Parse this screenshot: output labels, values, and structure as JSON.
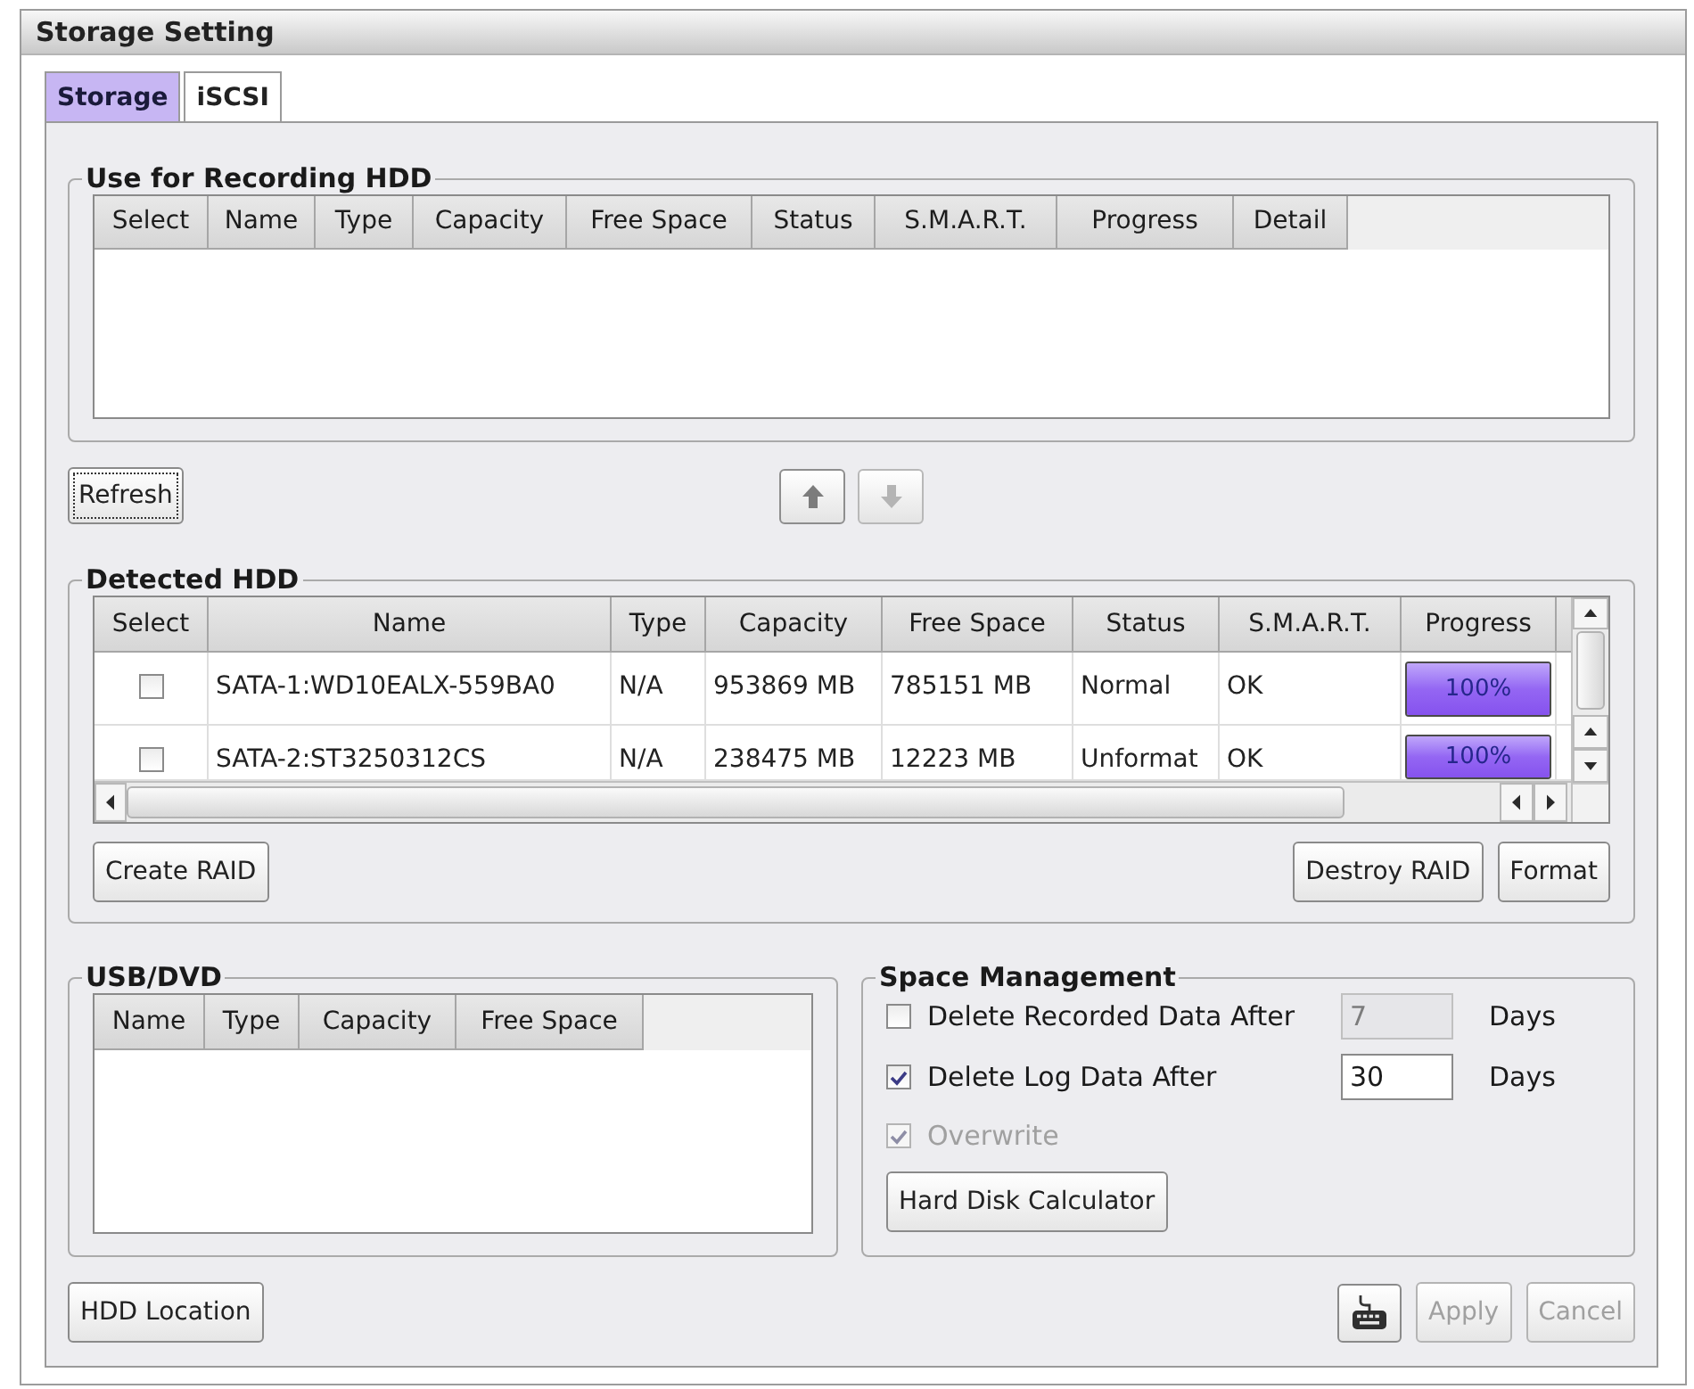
{
  "window": {
    "title": "Storage Setting"
  },
  "tabs": [
    {
      "label": "Storage",
      "selected": true
    },
    {
      "label": "iSCSI",
      "selected": false
    }
  ],
  "recording_hdd": {
    "title": "Use for Recording HDD",
    "columns": [
      "Select",
      "Name",
      "Type",
      "Capacity",
      "Free Space",
      "Status",
      "S.M.A.R.T.",
      "Progress",
      "Detail"
    ]
  },
  "refresh_button": {
    "label": "Refresh",
    "focused": true
  },
  "order_buttons": [
    {
      "kind": "up",
      "disabled": false
    },
    {
      "kind": "down",
      "disabled": true
    }
  ],
  "detected_hdd": {
    "title": "Detected HDD",
    "columns": [
      "Select",
      "Name",
      "Type",
      "Capacity",
      "Free Space",
      "Status",
      "S.M.A.R.T.",
      "Progress"
    ],
    "rows": [
      {
        "checked": false,
        "name": "SATA-1:WD10EALX-559BA0",
        "type": "N/A",
        "capacity": "953869 MB",
        "free_space": "785151 MB",
        "status": "Normal",
        "smart": "OK",
        "progress": {
          "level": 1,
          "reading": "100%"
        }
      },
      {
        "checked": false,
        "name": "SATA-2:ST3250312CS",
        "type": "N/A",
        "capacity": "238475 MB",
        "free_space": "12223 MB",
        "status": "Unformat",
        "smart": "OK",
        "progress": {
          "level": 1,
          "reading": "100%"
        }
      }
    ],
    "left_buttons": [
      "Create RAID"
    ],
    "right_buttons": [
      "Destroy RAID",
      "Format"
    ]
  },
  "usb_dvd": {
    "title": "USB/DVD",
    "columns": [
      "Name",
      "Type",
      "Capacity",
      "Free Space"
    ]
  },
  "space_management": {
    "title": "Space Management",
    "options": [
      {
        "kind": "days",
        "label": "Delete Recorded Data After",
        "checked": false,
        "disabled": false,
        "field": {
          "value": "7",
          "disabled": true
        },
        "unit": "Days"
      },
      {
        "kind": "days",
        "label": "Delete Log Data After",
        "checked": true,
        "disabled": false,
        "field": {
          "value": "30",
          "disabled": false
        },
        "unit": "Days"
      },
      {
        "kind": "check",
        "label": "Overwrite",
        "checked": true,
        "disabled": true
      }
    ],
    "button": "Hard Disk Calculator"
  },
  "footer": {
    "left_button": "HDD Location",
    "buttons": [
      {
        "label": "Apply",
        "disabled": true
      },
      {
        "label": "Cancel",
        "disabled": true
      }
    ]
  }
}
